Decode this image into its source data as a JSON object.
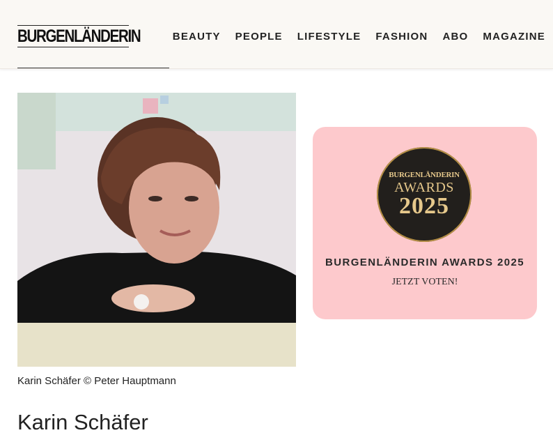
{
  "header": {
    "logo": "BURGENLÄNDERIN",
    "nav": [
      "BEAUTY",
      "PEOPLE",
      "LIFESTYLE",
      "FASHION",
      "ABO",
      "MAGAZINE"
    ]
  },
  "article": {
    "caption": "Karin Schäfer © Peter Hauptmann",
    "name": "Karin Schäfer"
  },
  "promo": {
    "badge_line1": "BURGENLÄNDERIN",
    "badge_line2": "AWARDS",
    "badge_line3": "2025",
    "title": "BURGENLÄNDERIN AWARDS 2025",
    "cta": "JETZT VOTEN!"
  },
  "colors": {
    "promo_background": "#fdc9cc",
    "badge_background": "#221f1c",
    "badge_gold": "#e6c88b"
  }
}
